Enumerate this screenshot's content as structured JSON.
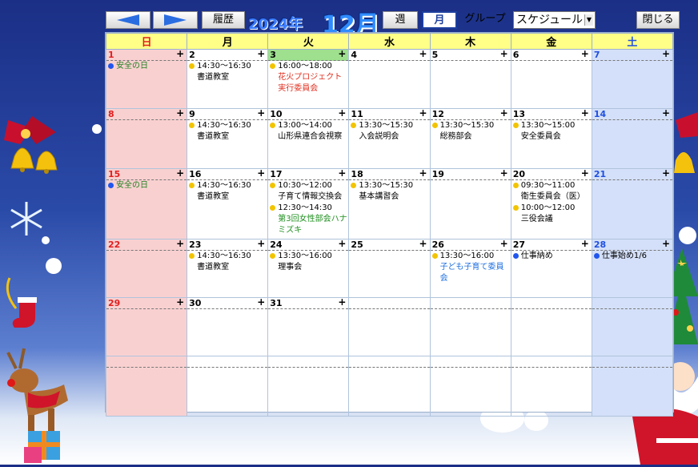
{
  "toolbar": {
    "prev_label": "",
    "next_label": "",
    "history_label": "履歴",
    "year_label": "2024年",
    "month_label": "12月",
    "week_label": "週",
    "month_view_label": "月",
    "group_label": "グループ",
    "schedule_select": "スケジュール",
    "close_label": "閉じる"
  },
  "weekdays": [
    "日",
    "月",
    "火",
    "水",
    "木",
    "金",
    "土"
  ],
  "plus": "+",
  "weeks": [
    [
      {
        "day": "1",
        "events": [
          {
            "dot": "b",
            "time": "",
            "text": "安全の日",
            "cls": "holi"
          }
        ]
      },
      {
        "day": "2",
        "events": [
          {
            "dot": "y",
            "time": "14:30～16:30",
            "text": "書道教室"
          }
        ]
      },
      {
        "day": "3",
        "today": true,
        "events": [
          {
            "dot": "y",
            "time": "16:00～18:00",
            "text": "花火プロジェクト実行委員会",
            "color": "red"
          }
        ]
      },
      {
        "day": "4",
        "events": []
      },
      {
        "day": "5",
        "events": []
      },
      {
        "day": "6",
        "events": []
      },
      {
        "day": "7",
        "events": []
      }
    ],
    [
      {
        "day": "8",
        "events": []
      },
      {
        "day": "9",
        "events": [
          {
            "dot": "y",
            "time": "14:30～16:30",
            "text": "書道教室"
          }
        ]
      },
      {
        "day": "10",
        "events": [
          {
            "dot": "y",
            "time": "13:00～14:00",
            "text": "山形県連合会視察"
          }
        ]
      },
      {
        "day": "11",
        "events": [
          {
            "dot": "y",
            "time": "13:30～15:30",
            "text": "入会説明会"
          }
        ]
      },
      {
        "day": "12",
        "events": [
          {
            "dot": "y",
            "time": "13:30～15:30",
            "text": "総務部会"
          }
        ]
      },
      {
        "day": "13",
        "events": [
          {
            "dot": "y",
            "time": "13:30～15:00",
            "text": "安全委員会"
          }
        ]
      },
      {
        "day": "14",
        "events": []
      }
    ],
    [
      {
        "day": "15",
        "events": [
          {
            "dot": "b",
            "time": "",
            "text": "安全の日",
            "cls": "holi"
          }
        ]
      },
      {
        "day": "16",
        "events": [
          {
            "dot": "y",
            "time": "14:30～16:30",
            "text": "書道教室"
          }
        ]
      },
      {
        "day": "17",
        "events": [
          {
            "dot": "y",
            "time": "10:30～12:00",
            "text": "子育て情報交換会"
          },
          {
            "dot": "y",
            "time": "12:30～14:30",
            "text": "第3回女性部会ハナミズキ",
            "color": "green"
          }
        ]
      },
      {
        "day": "18",
        "events": [
          {
            "dot": "y",
            "time": "13:30～15:30",
            "text": "基本講習会"
          }
        ]
      },
      {
        "day": "19",
        "events": []
      },
      {
        "day": "20",
        "events": [
          {
            "dot": "y",
            "time": "09:30～11:00",
            "text": "衛生委員会（医）"
          },
          {
            "dot": "y",
            "time": "10:00～12:00",
            "text": "三役会議"
          }
        ]
      },
      {
        "day": "21",
        "events": []
      }
    ],
    [
      {
        "day": "22",
        "events": []
      },
      {
        "day": "23",
        "events": [
          {
            "dot": "y",
            "time": "14:30～16:30",
            "text": "書道教室"
          }
        ]
      },
      {
        "day": "24",
        "events": [
          {
            "dot": "y",
            "time": "13:30～16:00",
            "text": "理事会"
          }
        ]
      },
      {
        "day": "25",
        "events": []
      },
      {
        "day": "26",
        "events": [
          {
            "dot": "y",
            "time": "13:30～16:00",
            "text": "子ども子育て委員会",
            "color": "blue"
          }
        ]
      },
      {
        "day": "27",
        "events": [
          {
            "dot": "b",
            "time": "",
            "text": "仕事納め"
          }
        ]
      },
      {
        "day": "28",
        "events": [
          {
            "dot": "b",
            "time": "",
            "text": "仕事始め1/6"
          }
        ]
      }
    ],
    [
      {
        "day": "29",
        "events": []
      },
      {
        "day": "30",
        "events": []
      },
      {
        "day": "31",
        "events": []
      },
      {
        "day": "",
        "events": []
      },
      {
        "day": "",
        "events": []
      },
      {
        "day": "",
        "events": []
      },
      {
        "day": "",
        "events": []
      }
    ],
    [
      {
        "day": "",
        "events": []
      },
      {
        "day": "",
        "events": []
      },
      {
        "day": "",
        "events": []
      },
      {
        "day": "",
        "events": []
      },
      {
        "day": "",
        "events": []
      },
      {
        "day": "",
        "events": []
      },
      {
        "day": "",
        "events": []
      }
    ]
  ]
}
